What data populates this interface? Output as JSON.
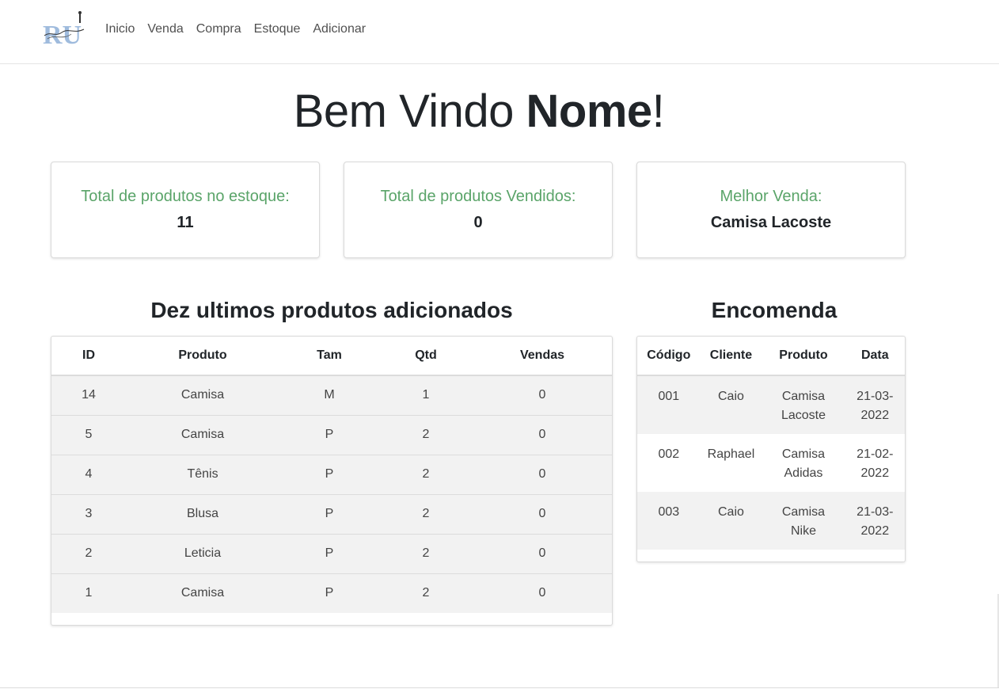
{
  "nav": {
    "logo_text": "RU",
    "links": [
      "Inicio",
      "Venda",
      "Compra",
      "Estoque",
      "Adicionar"
    ]
  },
  "welcome": {
    "prefix": "Bem Vindo ",
    "name": "Nome",
    "suffix": "!"
  },
  "cards": [
    {
      "label": "Total de produtos no estoque:",
      "value": "11"
    },
    {
      "label": "Total de produtos Vendidos:",
      "value": "0"
    },
    {
      "label": "Melhor Venda:",
      "value": "Camisa Lacoste"
    }
  ],
  "products": {
    "title": "Dez ultimos produtos adicionados",
    "columns": [
      "ID",
      "Produto",
      "Tam",
      "Qtd",
      "Vendas"
    ],
    "rows": [
      [
        "14",
        "Camisa",
        "M",
        "1",
        "0"
      ],
      [
        "5",
        "Camisa",
        "P",
        "2",
        "0"
      ],
      [
        "4",
        "Tênis",
        "P",
        "2",
        "0"
      ],
      [
        "3",
        "Blusa",
        "P",
        "2",
        "0"
      ],
      [
        "2",
        "Leticia",
        "P",
        "2",
        "0"
      ],
      [
        "1",
        "Camisa",
        "P",
        "2",
        "0"
      ]
    ]
  },
  "orders": {
    "title": "Encomenda",
    "columns": [
      "Código",
      "Cliente",
      "Produto",
      "Data"
    ],
    "rows": [
      {
        "code": "001",
        "client": "Caio",
        "product": [
          "Camisa",
          "Lacoste"
        ],
        "date": [
          "21-03-",
          "2022"
        ]
      },
      {
        "code": "002",
        "client": "Raphael",
        "product": [
          "Camisa",
          "Adidas"
        ],
        "date": [
          "21-02-",
          "2022"
        ]
      },
      {
        "code": "003",
        "client": "Caio",
        "product": [
          "Camisa",
          "Nike"
        ],
        "date": [
          "21-03-",
          "2022"
        ]
      }
    ]
  },
  "colors": {
    "card_label": "#5aa469",
    "row_stripe": "#f2f2f2",
    "logo_blue": "#8fb0d8"
  }
}
